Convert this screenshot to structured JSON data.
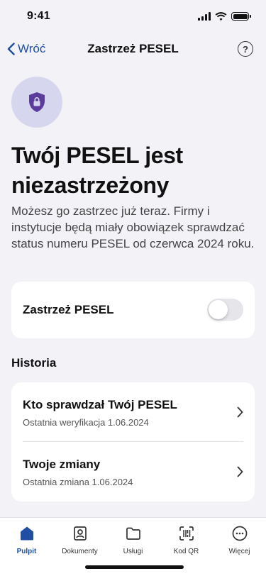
{
  "status_bar": {
    "time": "9:41"
  },
  "nav": {
    "back_label": "Wróć",
    "title": "Zastrzeż PESEL",
    "help_glyph": "?"
  },
  "hero": {
    "icon": "shield-lock-icon",
    "headline": "Twój PESEL jest niezastrzeżony",
    "description": "Możesz go zastrzec już teraz. Firmy i instytucje będą miały obowiązek sprawdzać status numeru PESEL od czerwca 2024 roku."
  },
  "toggle": {
    "label": "Zastrzeż PESEL",
    "on": false
  },
  "history": {
    "title": "Historia",
    "items": [
      {
        "title": "Kto sprawdzał Twój PESEL",
        "subtitle": "Ostatnia weryfikacja 1.06.2024"
      },
      {
        "title": "Twoje zmiany",
        "subtitle": "Ostatnia zmiana 1.06.2024"
      }
    ]
  },
  "tabs": [
    {
      "label": "Pulpit",
      "icon": "home-icon",
      "active": true
    },
    {
      "label": "Dokumenty",
      "icon": "id-card-icon",
      "active": false
    },
    {
      "label": "Usługi",
      "icon": "folder-icon",
      "active": false
    },
    {
      "label": "Kod QR",
      "icon": "qr-scan-icon",
      "active": false
    },
    {
      "label": "Więcej",
      "icon": "more-icon",
      "active": false
    }
  ],
  "colors": {
    "accent": "#1f4ea3",
    "shield": "#5b3b9c",
    "shield_bg": "#d6d6ef",
    "background": "#f2f2f7"
  }
}
